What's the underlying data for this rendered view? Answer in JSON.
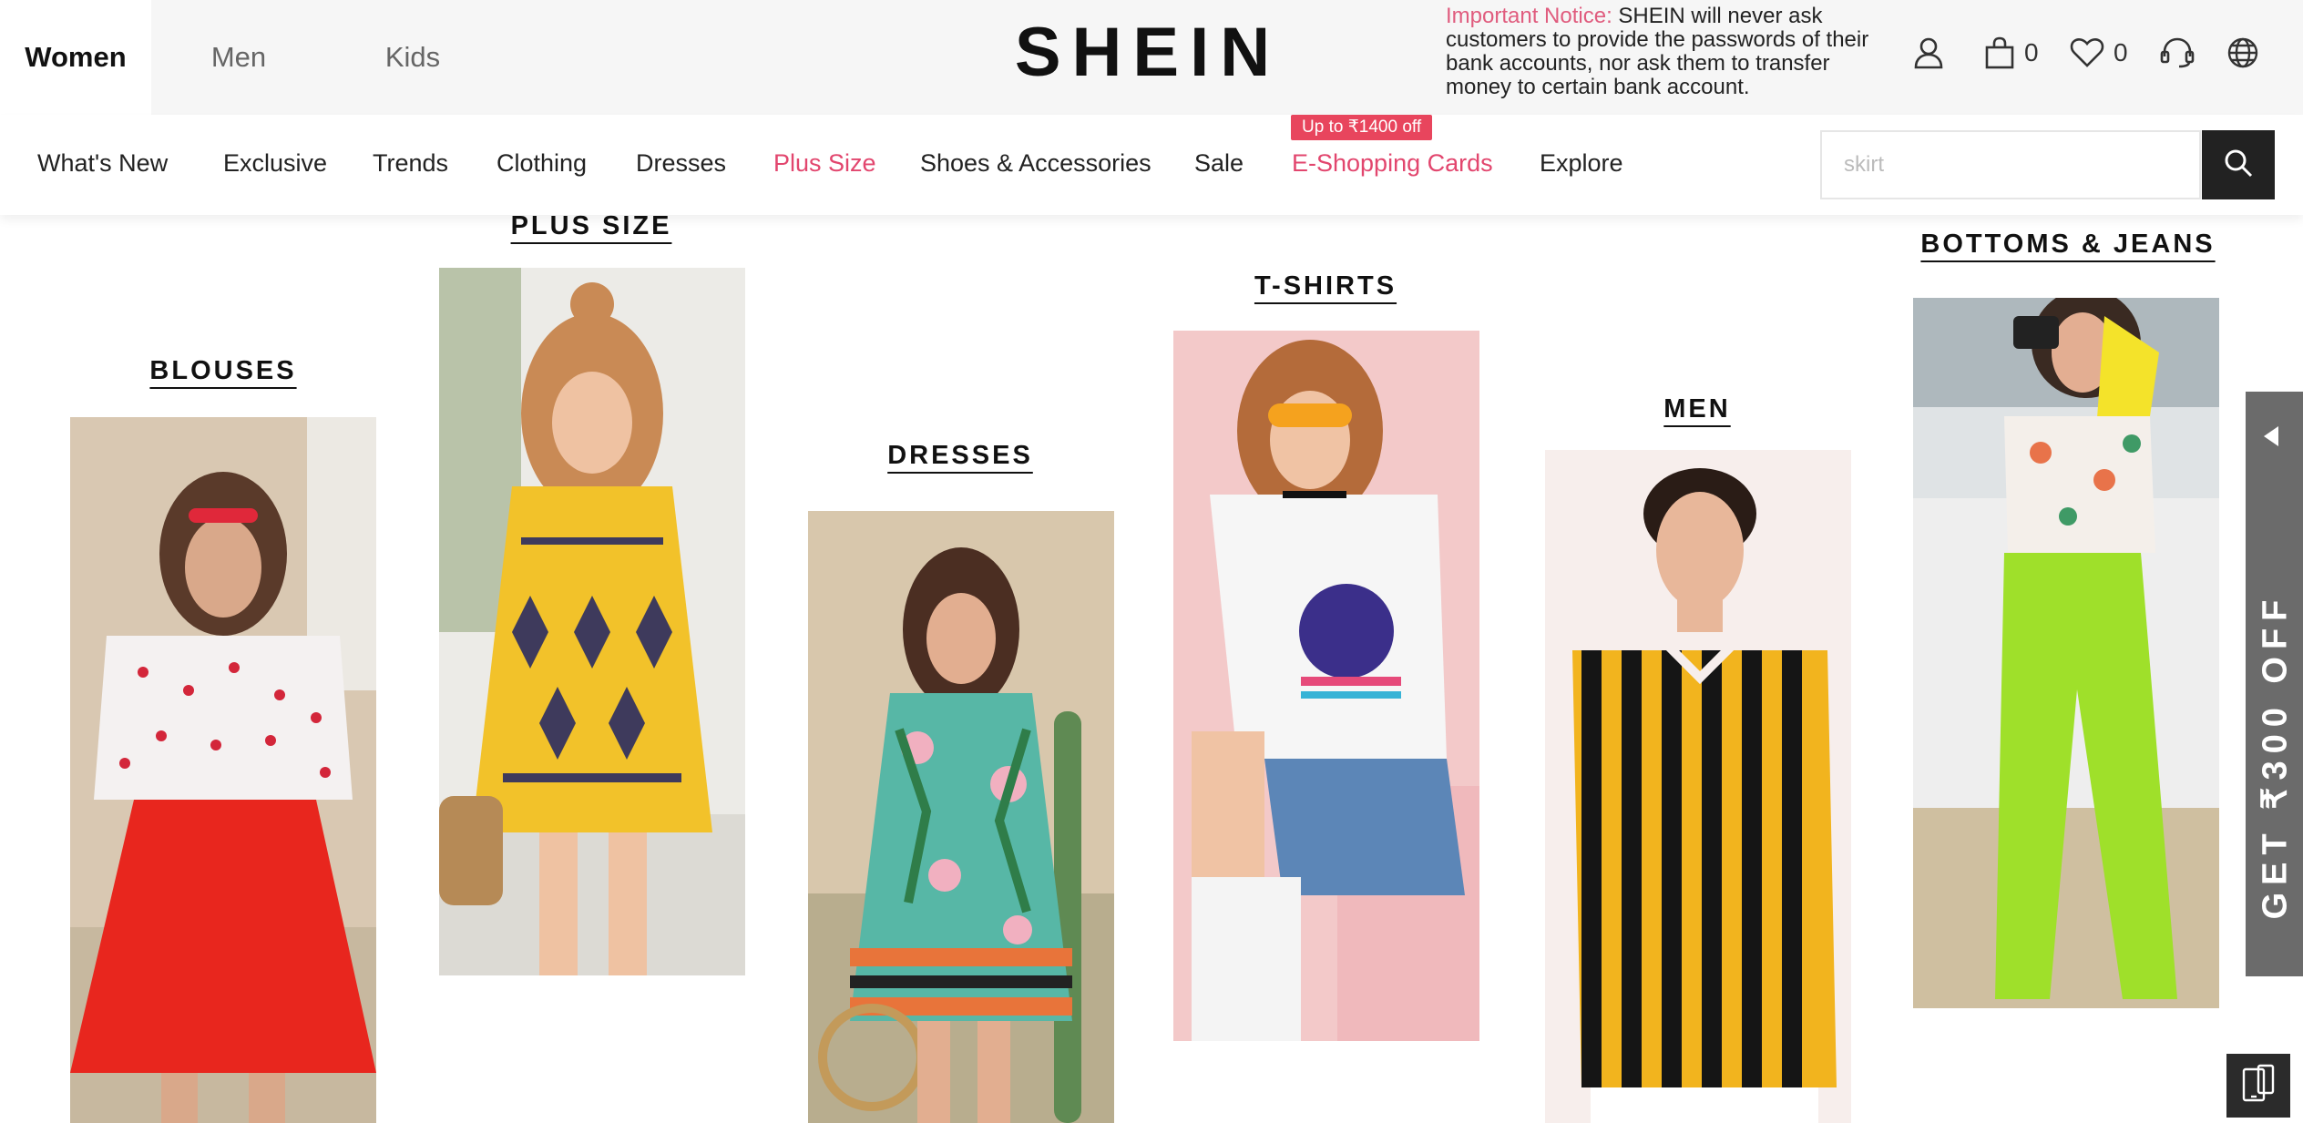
{
  "header": {
    "gender_tabs": [
      {
        "label": "Women",
        "active": true
      },
      {
        "label": "Men",
        "active": false
      },
      {
        "label": "Kids",
        "active": false
      }
    ],
    "logo": "SHEIN",
    "notice": {
      "label": "Important Notice:",
      "text": " SHEIN will never ask customers to provide the passwords of their bank accounts, nor ask them to transfer money to certain bank account."
    },
    "utilities": {
      "account_icon": "user-icon",
      "bag_icon": "shopping-bag-icon",
      "bag_count": "0",
      "wishlist_icon": "heart-icon",
      "wishlist_count": "0",
      "support_icon": "headset-icon",
      "region_icon": "globe-icon"
    }
  },
  "nav": {
    "items": [
      {
        "label": "What's New"
      },
      {
        "label": "Exclusive"
      },
      {
        "label": "Trends"
      },
      {
        "label": "Clothing"
      },
      {
        "label": "Dresses"
      },
      {
        "label": "Plus Size",
        "highlight": true
      },
      {
        "label": "Shoes & Accessories"
      },
      {
        "label": "Sale"
      },
      {
        "label": "E-Shopping Cards",
        "highlight": true
      },
      {
        "label": "Explore"
      }
    ],
    "promo_badge": "Up to ₹1400 off"
  },
  "search": {
    "placeholder": "skirt",
    "icon": "search-icon"
  },
  "categories": [
    {
      "title": "BLOUSES"
    },
    {
      "title": "PLUS SIZE"
    },
    {
      "title": "DRESSES"
    },
    {
      "title": "T-SHIRTS"
    },
    {
      "title": "MEN"
    },
    {
      "title": "BOTTOMS & JEANS"
    }
  ],
  "side_promo": {
    "text": "GET ₹300 OFF",
    "icon": "arrow-left-icon"
  },
  "mobile_button": {
    "icon": "mobile-devices-icon"
  },
  "colors": {
    "accent_pink": "#e2466e",
    "badge_red": "#e8455d",
    "dark": "#222222",
    "side_promo_gray": "#6b6b6b"
  }
}
